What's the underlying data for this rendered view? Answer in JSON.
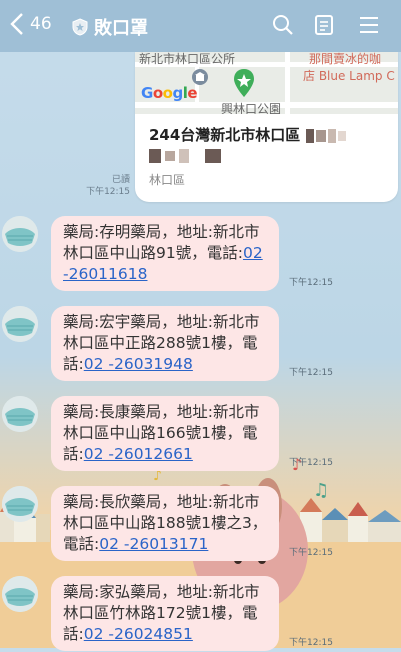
{
  "header": {
    "unread_count": "46",
    "title": "敗口罩"
  },
  "map_card": {
    "map_label_top": "新北市林口區公所",
    "map_label_shop_1": "那間賣冰的咖",
    "map_label_shop_2": "店 Blue Lamp C",
    "map_label_bottom": "興林口公園",
    "google_logo": "Google",
    "address_line1": "244台灣新北市林口區",
    "district": "林口區",
    "read_label": "已讀",
    "time": "下午12:15"
  },
  "messages": [
    {
      "text": "藥局:存明藥局，地址:新北市林口區中山路91號，電話:",
      "phone": "02 -26011618",
      "time": "下午12:15"
    },
    {
      "text": "藥局:宏宇藥局，地址:新北市林口區中正路288號1樓，電話:",
      "phone": "02 -26031948",
      "time": "下午12:15"
    },
    {
      "text": "藥局:長康藥局，地址:新北市林口區中山路166號1樓，電話:",
      "phone": "02 -26012661",
      "time": "下午12:15"
    },
    {
      "text": "藥局:長欣藥局，地址:新北市林口區中山路188號1樓之3，電話:",
      "phone": "02 -26013171",
      "time": "下午12:15"
    },
    {
      "text": "藥局:家弘藥局，地址:新北市林口區竹林路172號1樓，電話:",
      "phone": "02 -26024851",
      "time": "下午12:15"
    }
  ]
}
